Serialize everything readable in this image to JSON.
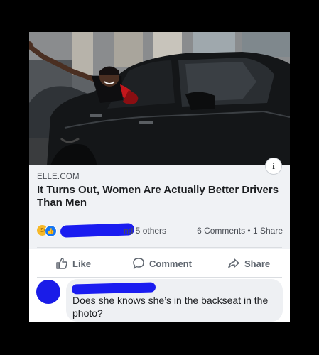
{
  "post": {
    "link_domain": "ELLE.COM",
    "headline": "It Turns Out, Women Are Actually Better Drivers Than Men",
    "info_icon": "i"
  },
  "reactions": {
    "icons": [
      "haha-reaction-icon",
      "like-reaction-icon"
    ],
    "others_text": "nd 5 others",
    "counts_text": "6 Comments • 1 Share"
  },
  "actions": {
    "like_label": "Like",
    "comment_label": "Comment",
    "share_label": "Share"
  },
  "comment": {
    "text": "Does she knows she’s in the backseat in the photo?"
  },
  "colors": {
    "background": "#000000",
    "redaction": "#1a1cf0",
    "link_meta_bg": "#f0f2f5",
    "action_text": "#606770"
  }
}
